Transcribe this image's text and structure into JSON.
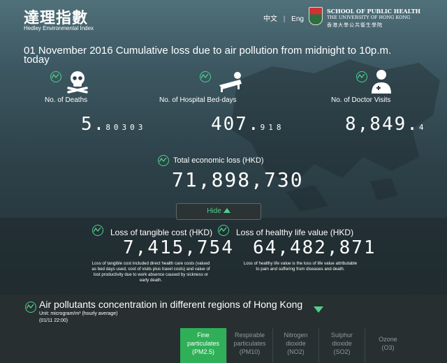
{
  "header": {
    "logo_cn": "達理指數",
    "logo_en": "Hedley Environmental Index",
    "lang_zh": "中文",
    "lang_sep": "|",
    "lang_en": "Eng",
    "hku_line1": "SCHOOL OF PUBLIC HEALTH",
    "hku_line2": "THE UNIVERSITY OF HONG KONG",
    "hku_line3": "香港大學公共衞生學院"
  },
  "headline": "01 November 2016 Cumulative loss due to air pollution from midnight to 10p.m. today",
  "stats": {
    "deaths": {
      "label": "No. of Deaths",
      "int": "5.",
      "dec": "80303"
    },
    "bed_days": {
      "label": "No. of Hospital Bed-days",
      "int": "407.",
      "dec": "918"
    },
    "doctor_visits": {
      "label": "No. of Doctor Visits",
      "int": "8,849.",
      "dec": "4"
    }
  },
  "total": {
    "label": "Total economic loss (HKD)",
    "value": "71,898,730"
  },
  "hide_label": "Hide",
  "tangible": {
    "label": "Loss of tangible cost (HKD)",
    "value": "7,415,754",
    "note": "Loss of tangible cost included direct health care costs (valued as bed days used, cost of visits plus travel costs) and value of lost productivity due to work absence caused by sickness or early death."
  },
  "healthy": {
    "label": "Loss of healthy life value (HKD)",
    "value": "64,482,871",
    "note": "Loss of healthy life value is the loss of life value attributable to pain and suffering from diseases and death."
  },
  "pollutants": {
    "title": "Air pollutants concentration in different regions of Hong Kong",
    "unit": "Unit: microgram/m³ (hourly average)",
    "time": "(01/11 22:00)",
    "tabs": [
      {
        "line1": "Fine",
        "line2": "particulates",
        "line3": "(PM2.5)"
      },
      {
        "line1": "Respirable",
        "line2": "particulates",
        "line3": "(PM10)"
      },
      {
        "line1": "Nitrogen",
        "line2": "dioxide",
        "line3": "(NO2)"
      },
      {
        "line1": "Sulphur",
        "line2": "dioxide",
        "line3": "(SO2)"
      },
      {
        "line1": "Ozone",
        "line2": "(O3)",
        "line3": ""
      }
    ]
  },
  "colors": {
    "accent": "#4fd18a",
    "tab_active": "#2faf57"
  }
}
